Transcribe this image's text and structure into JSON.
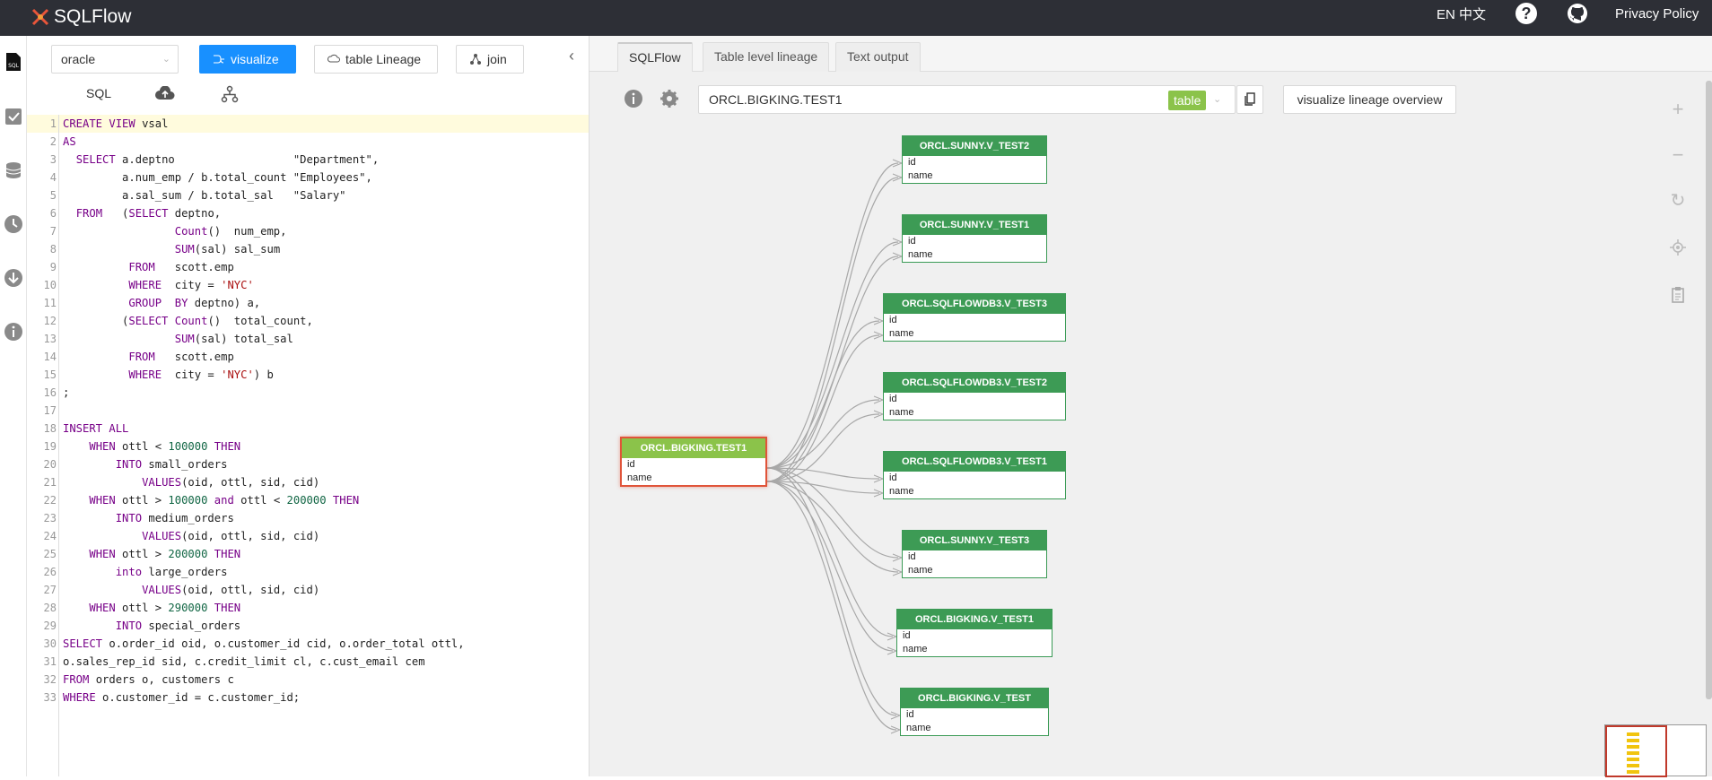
{
  "topbar": {
    "app_name": "SQLFlow",
    "lang": "EN 中文",
    "help_glyph": "?",
    "privacy": "Privacy Policy"
  },
  "toolbar": {
    "db_select": "oracle",
    "visualize": "visualize",
    "table_lineage": "table Lineage",
    "join": "join"
  },
  "subtabs": {
    "sql": "SQL"
  },
  "code_lines": [
    "CREATE VIEW vsal",
    "AS",
    "  SELECT a.deptno                  \"Department\",",
    "         a.num_emp / b.total_count \"Employees\",",
    "         a.sal_sum / b.total_sal   \"Salary\"",
    "  FROM   (SELECT deptno,",
    "                 Count()  num_emp,",
    "                 SUM(sal) sal_sum",
    "          FROM   scott.emp",
    "          WHERE  city = 'NYC'",
    "          GROUP  BY deptno) a,",
    "         (SELECT Count()  total_count,",
    "                 SUM(sal) total_sal",
    "          FROM   scott.emp",
    "          WHERE  city = 'NYC') b",
    ";",
    "",
    "INSERT ALL",
    "    WHEN ottl < 100000 THEN",
    "        INTO small_orders",
    "            VALUES(oid, ottl, sid, cid)",
    "    WHEN ottl > 100000 and ottl < 200000 THEN",
    "        INTO medium_orders",
    "            VALUES(oid, ottl, sid, cid)",
    "    WHEN ottl > 200000 THEN",
    "        into large_orders",
    "            VALUES(oid, ottl, sid, cid)",
    "    WHEN ottl > 290000 THEN",
    "        INTO special_orders",
    "SELECT o.order_id oid, o.customer_id cid, o.order_total ottl,",
    "o.sales_rep_id sid, c.credit_limit cl, c.cust_email cem",
    "FROM orders o, customers c",
    "WHERE o.customer_id = c.customer_id;"
  ],
  "right_tabs": [
    "SQLFlow",
    "Table level lineage",
    "Text output"
  ],
  "lineage_bar": {
    "selected_table": "ORCL.BIGKING.TEST1",
    "tag": "table",
    "overview_button": "visualize lineage overview"
  },
  "graph": {
    "source": {
      "name": "ORCL.BIGKING.TEST1",
      "columns": [
        "id",
        "name"
      ]
    },
    "targets": [
      {
        "name": "ORCL.SUNNY.V_TEST2",
        "columns": [
          "id",
          "name"
        ]
      },
      {
        "name": "ORCL.SUNNY.V_TEST1",
        "columns": [
          "id",
          "name"
        ]
      },
      {
        "name": "ORCL.SQLFLOWDB3.V_TEST3",
        "columns": [
          "id",
          "name"
        ]
      },
      {
        "name": "ORCL.SQLFLOWDB3.V_TEST2",
        "columns": [
          "id",
          "name"
        ]
      },
      {
        "name": "ORCL.SQLFLOWDB3.V_TEST1",
        "columns": [
          "id",
          "name"
        ]
      },
      {
        "name": "ORCL.SUNNY.V_TEST3",
        "columns": [
          "id",
          "name"
        ]
      },
      {
        "name": "ORCL.BIGKING.V_TEST1",
        "columns": [
          "id",
          "name"
        ]
      },
      {
        "name": "ORCL.BIGKING.V_TEST",
        "columns": [
          "id",
          "name"
        ]
      }
    ]
  },
  "colors": {
    "primary": "#1890ff",
    "node_header": "#3d9b55",
    "source_header": "#8bc34a",
    "source_border": "#e0543a",
    "topbar": "#2d2f36"
  }
}
